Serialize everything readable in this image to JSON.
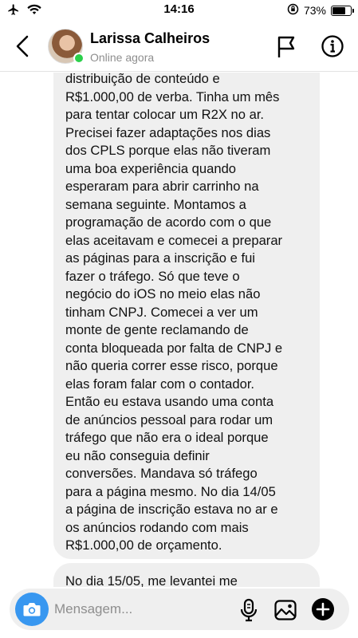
{
  "status_bar": {
    "time": "14:16",
    "battery_percent": "73%",
    "battery_level": 0.73,
    "icons": [
      "airplane-icon",
      "wifi-icon",
      "screen-rotation-lock-icon",
      "battery-icon"
    ]
  },
  "header": {
    "contact_name": "Larissa Calheiros",
    "contact_status": "Online agora",
    "icons": [
      "back-chevron-icon",
      "flag-icon",
      "info-icon"
    ]
  },
  "messages": [
    {
      "lines": [
        "distribuição de conteúdo e",
        "R$1.000,00 de verba. Tinha um mês",
        "para tentar colocar um R2X no ar.",
        "Precisei fazer adaptações nos dias",
        "dos CPLS porque elas não tiveram",
        "uma boa experiência quando",
        "esperaram para abrir carrinho na",
        "semana seguinte. Montamos a",
        "programação de acordo com o que",
        "elas aceitavam e comecei a preparar",
        "as páginas para a inscrição e fui",
        "fazer o tráfego. Só que teve o",
        "negócio do iOS no meio elas não",
        "tinham CNPJ. Comecei a ver um",
        "monte de gente reclamando de",
        "conta bloqueada por falta de CNPJ e",
        "não queria correr esse risco, porque",
        "elas foram falar com o contador.",
        "Então eu estava usando uma conta",
        "de anúncios pessoal para rodar um",
        "tráfego que não era o ideal porque",
        "eu não conseguia definir",
        "conversões. Mandava só tráfego",
        "para a página mesmo. No dia 14/05",
        "a página de inscrição estava no ar e",
        "os anúncios rodando com mais",
        "R$1.000,00 de orçamento."
      ]
    },
    {
      "lines": [
        "No dia 15/05, me levantei me"
      ]
    }
  ],
  "composer": {
    "placeholder": "Mensagem...",
    "value": "",
    "icons": [
      "camera-icon",
      "microphone-icon",
      "gallery-icon",
      "add-icon"
    ]
  },
  "colors": {
    "camera_button": "#3897f0",
    "online_dot": "#2bd04b",
    "bubble_background": "#efefef",
    "secondary_text": "#8e8e8e"
  }
}
